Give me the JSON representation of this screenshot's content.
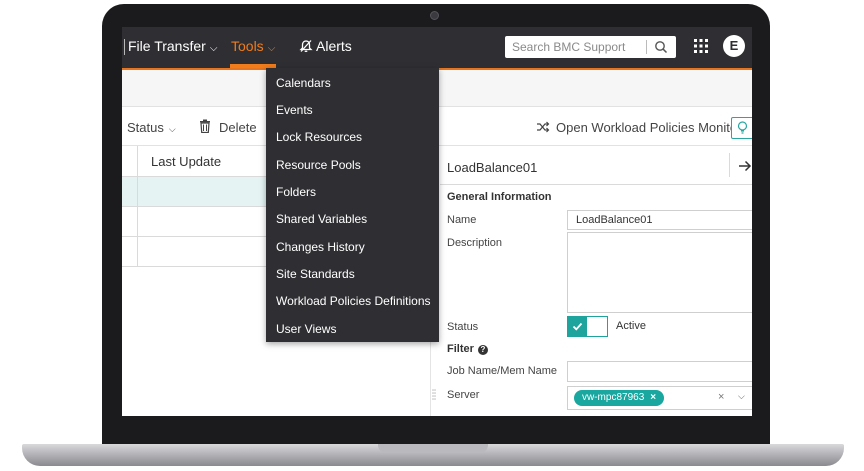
{
  "nav": {
    "file_transfer": "File Transfer",
    "tools": "Tools",
    "alerts": "Alerts",
    "search_placeholder": "Search BMC Support",
    "avatar_initial": "E"
  },
  "tools_menu": {
    "items": [
      "Calendars",
      "Events",
      "Lock Resources",
      "Resource Pools",
      "Folders",
      "Shared Variables",
      "Changes History",
      "Site Standards",
      "Workload Policies Definitions",
      "User Views"
    ]
  },
  "toolbar": {
    "status": "Status",
    "delete": "Delete",
    "open_monitor": "Open Workload Policies Monitor"
  },
  "table": {
    "columns": [
      "Last Update"
    ]
  },
  "detail": {
    "title": "LoadBalance01",
    "general_info": "General Information",
    "name_label": "Name",
    "name_value": "LoadBalance01",
    "description_label": "Description",
    "description_value": "",
    "status_label": "Status",
    "status_value": "Active",
    "filter_label": "Filter",
    "job_name_label": "Job Name/Mem Name",
    "job_name_value": "",
    "server_label": "Server",
    "server_chip": "vw-mpc87963"
  },
  "colors": {
    "nav_bg": "#2f2f33",
    "accent_orange": "#f07c1b",
    "accent_teal": "#19a79f"
  }
}
